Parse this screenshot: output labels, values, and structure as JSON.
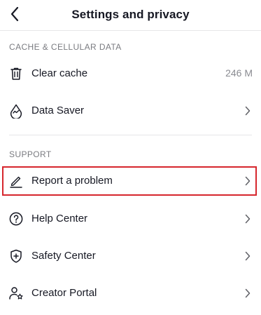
{
  "header": {
    "title": "Settings and privacy",
    "back_icon": "chevron-left-icon"
  },
  "sections": [
    {
      "title": "CACHE & CELLULAR DATA",
      "items": [
        {
          "label": "Clear cache",
          "value": "246 M",
          "icon": "trash-icon"
        },
        {
          "label": "Data Saver",
          "icon": "data-saver-icon"
        }
      ]
    },
    {
      "title": "SUPPORT",
      "items": [
        {
          "label": "Report a problem",
          "icon": "pencil-icon",
          "highlighted": true
        },
        {
          "label": "Help Center",
          "icon": "question-circle-icon"
        },
        {
          "label": "Safety Center",
          "icon": "shield-plus-icon"
        },
        {
          "label": "Creator Portal",
          "icon": "person-star-icon"
        }
      ]
    }
  ],
  "colors": {
    "text": "#161823",
    "secondary_text": "#7a7b80",
    "divider": "#e6e6e8",
    "highlight_border": "#d6262d"
  }
}
